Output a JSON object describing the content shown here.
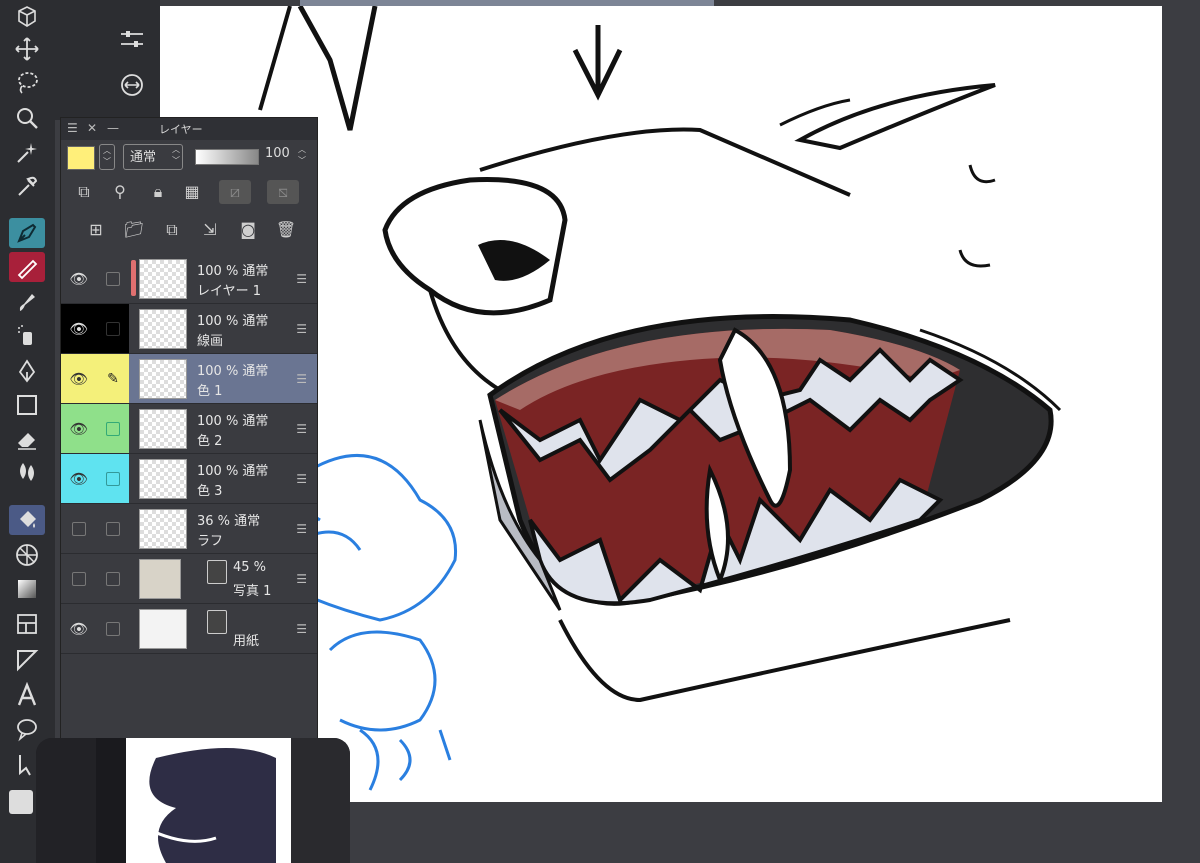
{
  "panel": {
    "title": "レイヤー",
    "blend_mode": "通常",
    "opacity": "100",
    "layers": [
      {
        "line1": "100 % 通常",
        "line2": "レイヤー 1"
      },
      {
        "line1": "100 % 通常",
        "line2": "線画"
      },
      {
        "line1": "100 % 通常",
        "line2": "色 1"
      },
      {
        "line1": "100 % 通常",
        "line2": "色 2"
      },
      {
        "line1": "100 % 通常",
        "line2": "色 3"
      },
      {
        "line1": "36 % 通常",
        "line2": "ラフ"
      },
      {
        "line1": "45 %",
        "line2": "写真 1"
      },
      {
        "line1": "",
        "line2": "用紙"
      }
    ]
  },
  "colors": {
    "accent_teal": "#3c8fa0",
    "selected_layer": "#6a7592",
    "yellow_tag": "#f4f07a",
    "green_tag": "#8fe08a",
    "cyan_tag": "#5fe3f0",
    "sketch_blue": "#2a7fe0"
  }
}
